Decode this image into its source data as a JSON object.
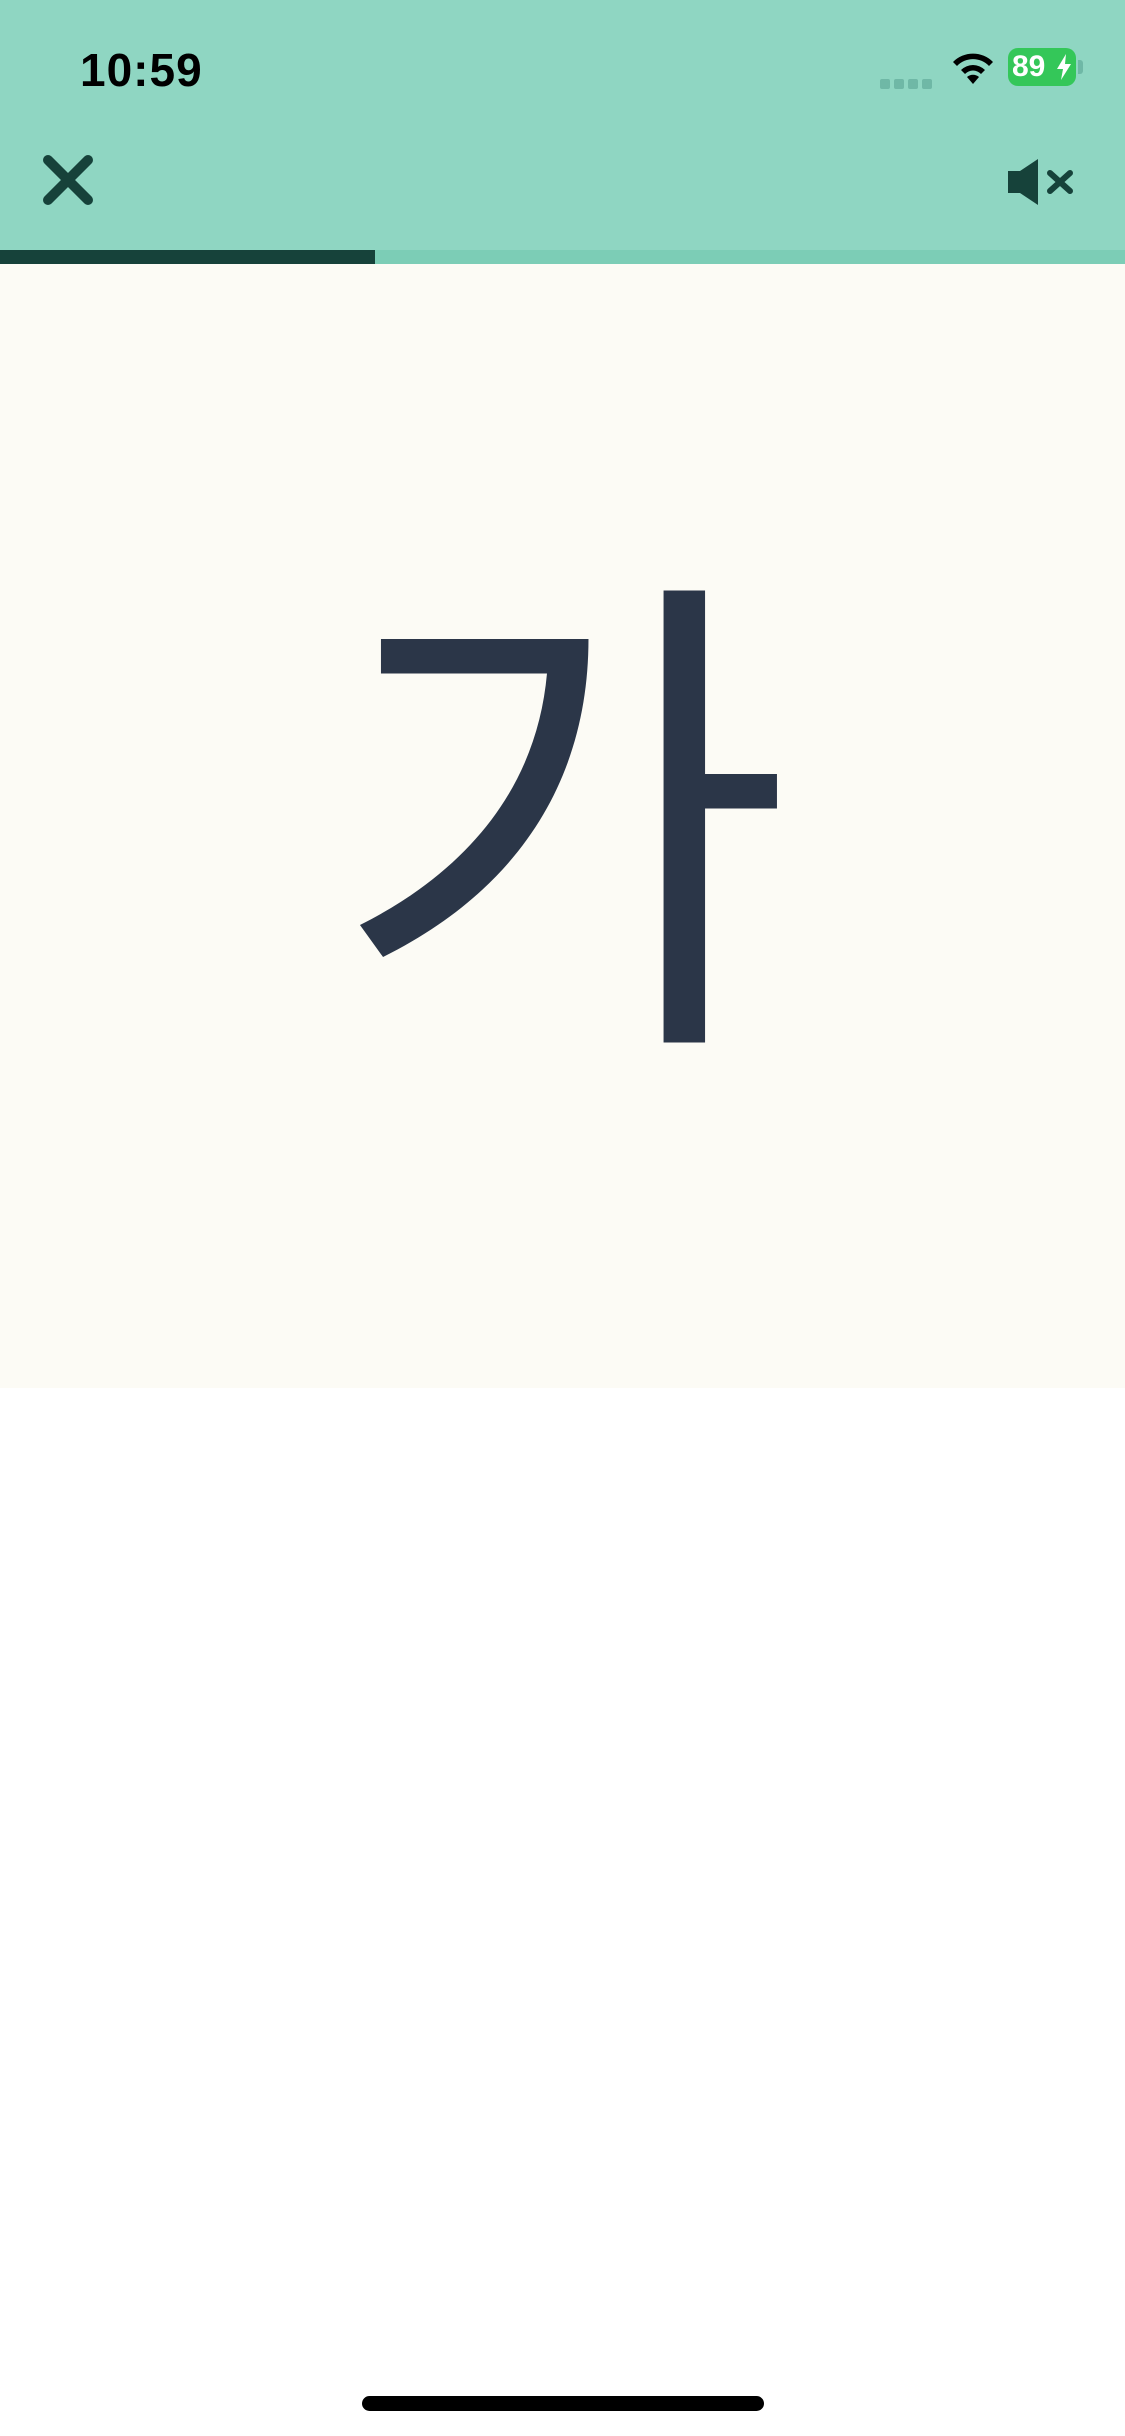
{
  "status_bar": {
    "time": "10:59",
    "battery_level": "89"
  },
  "toolbar": {
    "close_icon": "close-icon",
    "mute_icon": "speaker-muted-icon"
  },
  "progress": {
    "fraction": 0.333
  },
  "card": {
    "character": "가"
  },
  "colors": {
    "header_background": "#8fd6c2",
    "progress_fill": "#16423a",
    "progress_track": "#7ccdb6",
    "card_background": "#fcfbf5",
    "glyph": "#2b3648",
    "battery": "#34c759"
  }
}
